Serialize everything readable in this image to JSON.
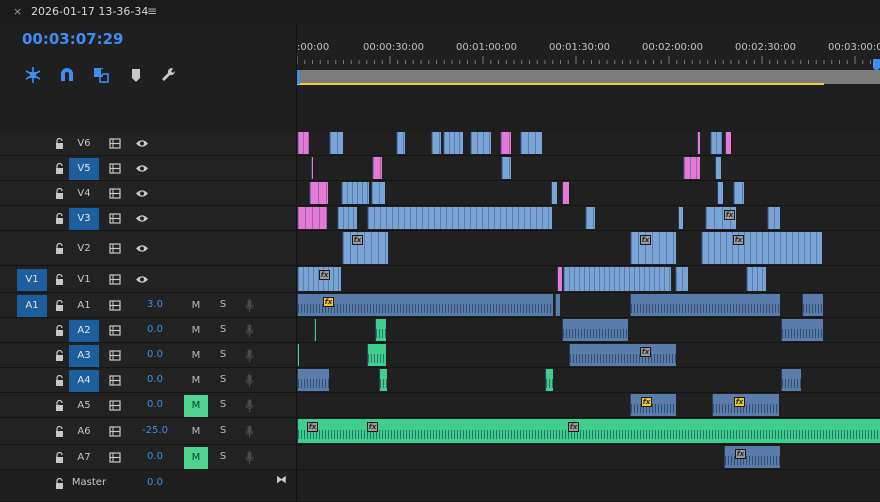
{
  "window": {
    "close_glyph": "×",
    "sequence_name": "2026-01-17 13-36-34",
    "menu_glyph": "≡"
  },
  "playhead": {
    "timecode": "00:03:07:29"
  },
  "toolbar": {
    "tools": [
      {
        "name": "insert-nest-icon",
        "color": "#3d8ef0"
      },
      {
        "name": "snap-magnet-icon",
        "color": "#3d8ef0"
      },
      {
        "name": "linked-selection-icon",
        "color": "#3d8ef0"
      },
      {
        "name": "add-marker-icon",
        "color": "#c8c8c8"
      },
      {
        "name": "timeline-settings-wrench-icon",
        "color": "#c8c8c8"
      }
    ]
  },
  "ruler": {
    "labels": [
      ":00:00",
      "00:00:30:00",
      "00:01:00:00",
      "00:01:30:00",
      "00:02:00:00",
      "00:02:30:00",
      "00:03:00:00"
    ]
  },
  "video_tracks": [
    {
      "name": "V6",
      "selected": false,
      "source": ""
    },
    {
      "name": "V5",
      "selected": true,
      "source": ""
    },
    {
      "name": "V4",
      "selected": false,
      "source": ""
    },
    {
      "name": "V3",
      "selected": true,
      "source": ""
    },
    {
      "name": "V2",
      "selected": false,
      "source": ""
    },
    {
      "name": "V1",
      "selected": false,
      "source": "V1"
    }
  ],
  "audio_tracks": [
    {
      "name": "A1",
      "selected": false,
      "source": "A1",
      "volume": "3.0",
      "mute": "M",
      "mute_on": false,
      "solo": "S"
    },
    {
      "name": "A2",
      "selected": true,
      "source": "",
      "volume": "0.0",
      "mute": "M",
      "mute_on": false,
      "solo": "S"
    },
    {
      "name": "A3",
      "selected": true,
      "source": "",
      "volume": "0.0",
      "mute": "M",
      "mute_on": false,
      "solo": "S"
    },
    {
      "name": "A4",
      "selected": true,
      "source": "",
      "volume": "0.0",
      "mute": "M",
      "mute_on": false,
      "solo": "S"
    },
    {
      "name": "A5",
      "selected": false,
      "source": "",
      "volume": "0.0",
      "mute": "M",
      "mute_on": true,
      "solo": "S"
    },
    {
      "name": "A6",
      "selected": false,
      "source": "",
      "volume": "-25.0",
      "mute": "M",
      "mute_on": false,
      "solo": "S"
    },
    {
      "name": "A7",
      "selected": false,
      "source": "",
      "volume": "0.0",
      "mute": "M",
      "mute_on": true,
      "solo": "S"
    }
  ],
  "master": {
    "name": "Master",
    "volume": "0.0",
    "end_icon": "⧓"
  },
  "fx_badge": "fx",
  "colors": {
    "accent_blue": "#3d8ef0",
    "selected_track": "#1d5f9e",
    "video_clip": "#7aa3d6",
    "video_clip_pink": "#e57ad6",
    "audio_clip": "#5a7caa",
    "audio_clip_green": "#3ecf8e",
    "mute_on": "#4fd58f",
    "work_area": "#e8d23a",
    "fx_yellow": "#f2c72c",
    "fx_gray": "#9a9a9a"
  }
}
